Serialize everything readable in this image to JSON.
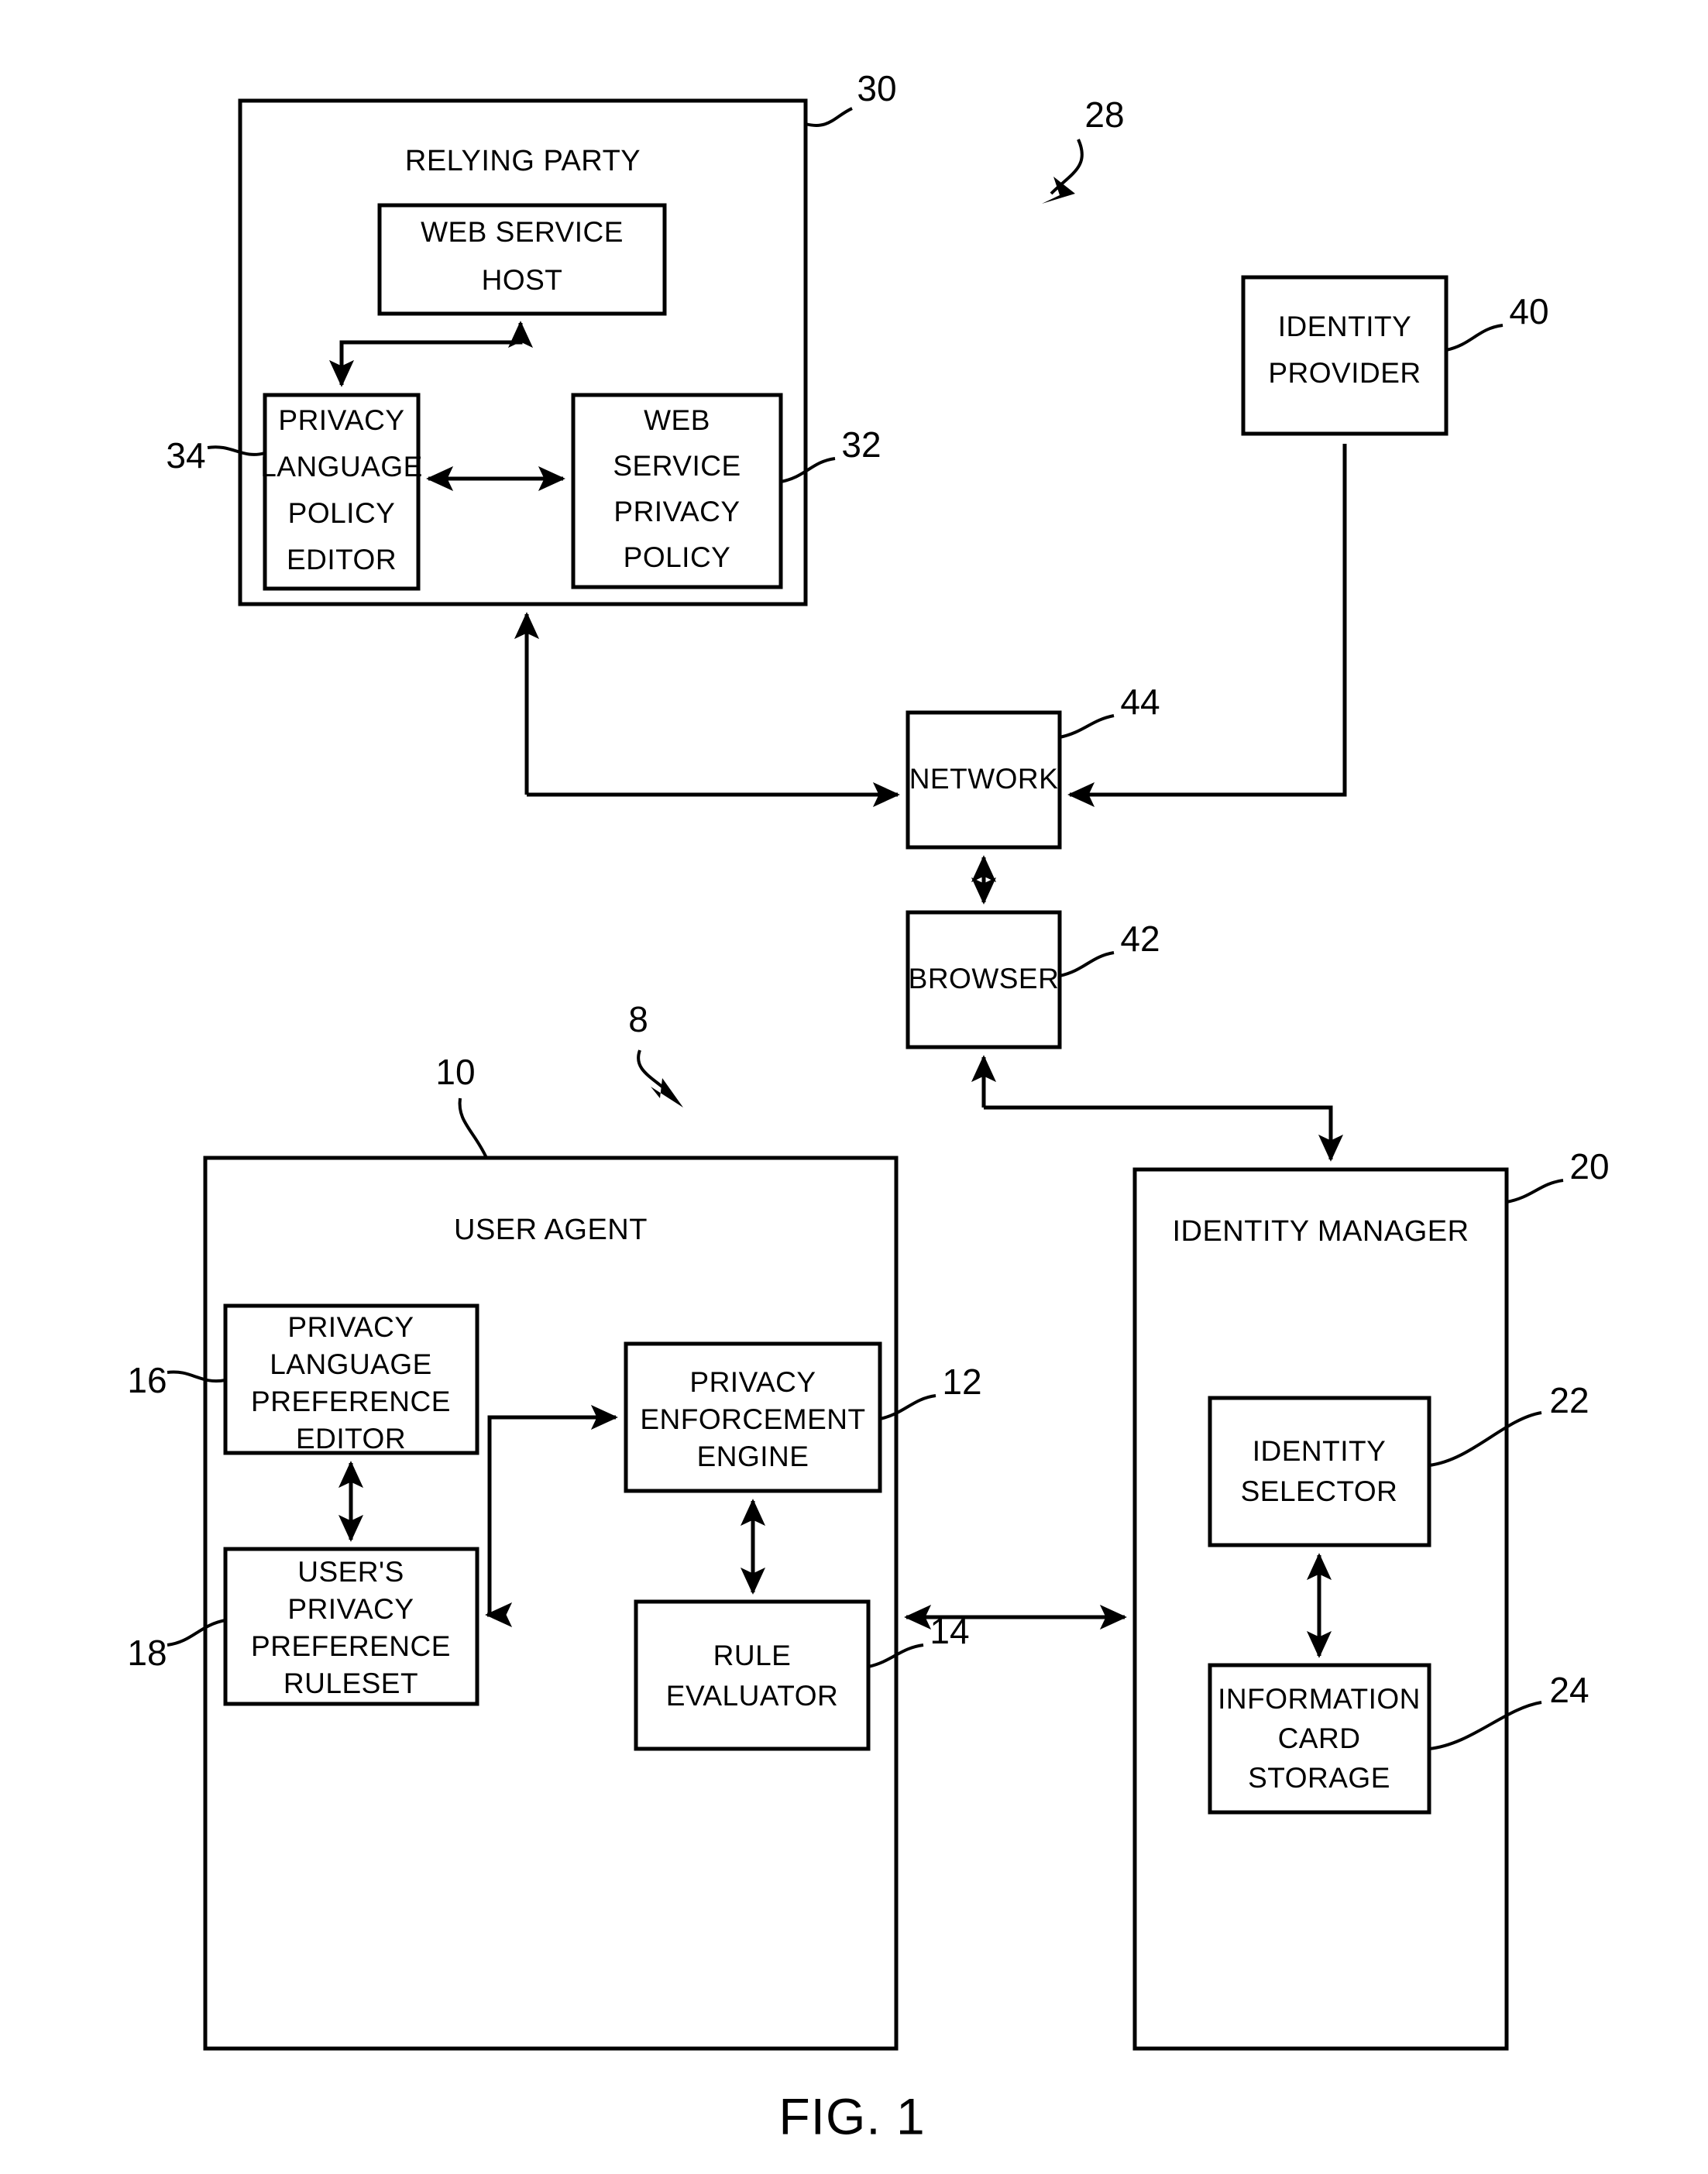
{
  "figure": {
    "caption": "FIG. 1",
    "system_refs": {
      "client_system": "8",
      "server_system": "28"
    }
  },
  "blocks": {
    "relying_party": {
      "label": "RELYING PARTY",
      "ref": "30",
      "children": {
        "web_service_host": {
          "label_line1": "WEB SERVICE",
          "label_line2": "HOST"
        },
        "privacy_language_policy_editor": {
          "label_line1": "PRIVACY",
          "label_line2": "LANGUAGE",
          "label_line3": "POLICY",
          "label_line4": "EDITOR",
          "ref": "34"
        },
        "web_service_privacy_policy": {
          "label_line1": "WEB",
          "label_line2": "SERVICE",
          "label_line3": "PRIVACY",
          "label_line4": "POLICY",
          "ref": "32"
        }
      }
    },
    "identity_provider": {
      "label_line1": "IDENTITY",
      "label_line2": "PROVIDER",
      "ref": "40"
    },
    "network": {
      "label": "NETWORK",
      "ref": "44"
    },
    "browser": {
      "label": "BROWSER",
      "ref": "42"
    },
    "user_agent": {
      "label": "USER AGENT",
      "ref": "10",
      "children": {
        "privacy_language_preference_editor": {
          "label_line1": "PRIVACY",
          "label_line2": "LANGUAGE",
          "label_line3": "PREFERENCE",
          "label_line4": "EDITOR",
          "ref": "16"
        },
        "users_privacy_preference_ruleset": {
          "label_line1": "USER'S",
          "label_line2": "PRIVACY",
          "label_line3": "PREFERENCE",
          "label_line4": "RULESET",
          "ref": "18"
        },
        "privacy_enforcement_engine": {
          "label_line1": "PRIVACY",
          "label_line2": "ENFORCEMENT",
          "label_line3": "ENGINE",
          "ref": "12"
        },
        "rule_evaluator": {
          "label_line1": "RULE",
          "label_line2": "EVALUATOR",
          "ref": "14"
        }
      }
    },
    "identity_manager": {
      "label": "IDENTITY MANAGER",
      "ref": "20",
      "children": {
        "identity_selector": {
          "label_line1": "IDENTITY",
          "label_line2": "SELECTOR",
          "ref": "22"
        },
        "information_card_storage": {
          "label_line1": "INFORMATION",
          "label_line2": "CARD",
          "label_line3": "STORAGE",
          "ref": "24"
        }
      }
    }
  },
  "style": {
    "stroke_color": "#000000",
    "fill_color": "#ffffff"
  }
}
